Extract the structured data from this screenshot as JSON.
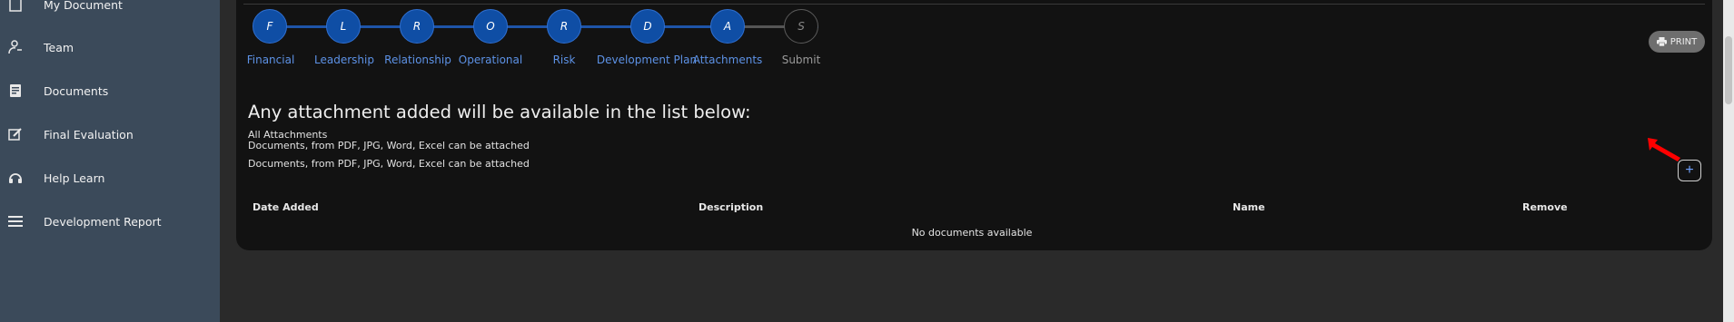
{
  "sidebar": {
    "items": [
      {
        "label": "My Document",
        "icon": "document-icon"
      },
      {
        "label": "Team",
        "icon": "team-icon"
      },
      {
        "label": "Documents",
        "icon": "documents-icon"
      },
      {
        "label": "Final Evaluation",
        "icon": "edit-icon"
      },
      {
        "label": "Help Learn",
        "icon": "headset-icon"
      },
      {
        "label": "Development Report",
        "icon": "list-icon"
      }
    ]
  },
  "stepper": {
    "steps": [
      {
        "letter": "F",
        "label": "Financial",
        "status": "done"
      },
      {
        "letter": "L",
        "label": "Leadership",
        "status": "done"
      },
      {
        "letter": "R",
        "label": "Relationship",
        "status": "done"
      },
      {
        "letter": "O",
        "label": "Operational",
        "status": "done"
      },
      {
        "letter": "R",
        "label": "Risk",
        "status": "done"
      },
      {
        "letter": "D",
        "label": "Development Plan",
        "status": "done"
      },
      {
        "letter": "A",
        "label": "Attachments",
        "status": "current"
      },
      {
        "letter": "S",
        "label": "Submit",
        "status": "pending"
      }
    ]
  },
  "toolbar": {
    "print_label": "PRINT",
    "print_icon": "printer-icon",
    "add_label": "+"
  },
  "attachments": {
    "headline": "Any attachment added will be available in the list below:",
    "section_title": "All Attachments",
    "hint_1": "Documents, from PDF, JPG, Word, Excel can be attached",
    "hint_2": "Documents, from PDF, JPG, Word, Excel can be attached"
  },
  "table": {
    "columns": [
      "Date Added",
      "Description",
      "Name",
      "Remove"
    ],
    "empty_message": "No documents available"
  },
  "colors": {
    "sidebar_bg": "#3b4a5a",
    "step_active": "#0f4ea5",
    "step_label": "#5d92e6",
    "annotation_arrow": "#ff0000"
  }
}
